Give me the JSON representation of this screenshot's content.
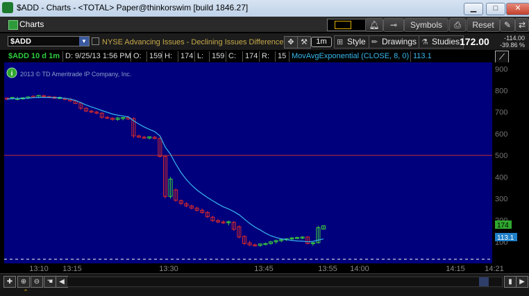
{
  "window": {
    "title": "$ADD - Charts - <TOTAL> Paper@thinkorswim [build 1846.27]",
    "minimize": "▁",
    "maximize": "□",
    "close": "✕"
  },
  "toolbar": {
    "tab_label": "Charts",
    "symbols_label": "Symbols",
    "reset_label": "Reset",
    "alert_icon": "bell-icon",
    "key_icon": "key-icon",
    "print_icon": "printer-icon",
    "pin_icon": "pin-icon"
  },
  "chartbar": {
    "symbol": "$ADD",
    "description": "NYSE Advancing Issues - Declining Issues Difference",
    "aggregation": "1m",
    "style_label": "Style",
    "drawings_label": "Drawings",
    "studies_label": "Studies",
    "last_price": "172.00",
    "net_change": "-114.00",
    "pct_change": "-39.86 %"
  },
  "studybar": {
    "symbol_period": "$ADD 10 d 1m",
    "date": "D: 9/25/13 1:56 PM",
    "o_label": "O:",
    "o_value": "159",
    "h_label": "H:",
    "h_value": "174",
    "l_label": "L:",
    "l_value": "159",
    "c_label": "C:",
    "c_value": "174",
    "r_label": "R:",
    "r_value": "15",
    "study": "MovAvgExponential (CLOSE, 8, 0)",
    "study_value": "113.1"
  },
  "chart": {
    "copyright": "2013 © TD Ameritrade IP Company, Inc.",
    "info_icon": "info-icon",
    "price_label": "174",
    "ema_label": "113.1",
    "colors": {
      "background": "#00007c",
      "up": "#3cd23c",
      "down": "#dd2a2a",
      "ema": "#38b8f0",
      "ref_line": "#c03030",
      "price_tag": "#2fa82f",
      "ema_tag": "#1f7fc8"
    }
  },
  "chart_data": {
    "type": "candlestick",
    "yticks": [
      900,
      800,
      700,
      600,
      500,
      400,
      300,
      200,
      100
    ],
    "y_range": [
      0,
      930
    ],
    "xtick_labels": [
      "13:10",
      "13:15",
      "13:30",
      "13:45",
      "13:55",
      "14:00",
      "14:15",
      "14:21"
    ],
    "reference_line": 500,
    "candles": [
      {
        "o": 765,
        "h": 768,
        "l": 755,
        "c": 760
      },
      {
        "o": 765,
        "h": 770,
        "l": 758,
        "c": 768
      },
      {
        "o": 762,
        "h": 770,
        "l": 755,
        "c": 763
      },
      {
        "o": 763,
        "h": 769,
        "l": 758,
        "c": 766
      },
      {
        "o": 765,
        "h": 772,
        "l": 760,
        "c": 770
      },
      {
        "o": 773,
        "h": 778,
        "l": 765,
        "c": 768
      },
      {
        "o": 768,
        "h": 780,
        "l": 765,
        "c": 777
      },
      {
        "o": 776,
        "h": 780,
        "l": 768,
        "c": 772
      },
      {
        "o": 772,
        "h": 775,
        "l": 765,
        "c": 768
      },
      {
        "o": 770,
        "h": 772,
        "l": 762,
        "c": 764
      },
      {
        "o": 765,
        "h": 772,
        "l": 760,
        "c": 768
      },
      {
        "o": 763,
        "h": 768,
        "l": 755,
        "c": 760
      },
      {
        "o": 760,
        "h": 765,
        "l": 748,
        "c": 752
      },
      {
        "o": 752,
        "h": 756,
        "l": 738,
        "c": 740
      },
      {
        "o": 742,
        "h": 746,
        "l": 710,
        "c": 718
      },
      {
        "o": 718,
        "h": 722,
        "l": 700,
        "c": 705
      },
      {
        "o": 705,
        "h": 710,
        "l": 695,
        "c": 700
      },
      {
        "o": 700,
        "h": 706,
        "l": 690,
        "c": 695
      },
      {
        "o": 695,
        "h": 700,
        "l": 670,
        "c": 676
      },
      {
        "o": 676,
        "h": 682,
        "l": 668,
        "c": 672
      },
      {
        "o": 672,
        "h": 676,
        "l": 660,
        "c": 666
      },
      {
        "o": 666,
        "h": 678,
        "l": 660,
        "c": 673
      },
      {
        "o": 670,
        "h": 677,
        "l": 662,
        "c": 675
      },
      {
        "o": 675,
        "h": 680,
        "l": 664,
        "c": 668
      },
      {
        "o": 670,
        "h": 676,
        "l": 580,
        "c": 590
      },
      {
        "o": 590,
        "h": 596,
        "l": 580,
        "c": 584
      },
      {
        "o": 584,
        "h": 590,
        "l": 578,
        "c": 582
      },
      {
        "o": 580,
        "h": 588,
        "l": 574,
        "c": 586
      },
      {
        "o": 584,
        "h": 590,
        "l": 574,
        "c": 578
      },
      {
        "o": 578,
        "h": 582,
        "l": 490,
        "c": 495
      },
      {
        "o": 495,
        "h": 500,
        "l": 300,
        "c": 310
      },
      {
        "o": 310,
        "h": 400,
        "l": 300,
        "c": 390
      },
      {
        "o": 340,
        "h": 346,
        "l": 285,
        "c": 292
      },
      {
        "o": 290,
        "h": 296,
        "l": 270,
        "c": 278
      },
      {
        "o": 276,
        "h": 284,
        "l": 260,
        "c": 266
      },
      {
        "o": 266,
        "h": 272,
        "l": 250,
        "c": 256
      },
      {
        "o": 256,
        "h": 262,
        "l": 240,
        "c": 246
      },
      {
        "o": 246,
        "h": 254,
        "l": 230,
        "c": 236
      },
      {
        "o": 236,
        "h": 242,
        "l": 210,
        "c": 216
      },
      {
        "o": 214,
        "h": 220,
        "l": 192,
        "c": 198
      },
      {
        "o": 198,
        "h": 206,
        "l": 186,
        "c": 192
      },
      {
        "o": 192,
        "h": 200,
        "l": 182,
        "c": 188
      },
      {
        "o": 188,
        "h": 198,
        "l": 176,
        "c": 193
      },
      {
        "o": 190,
        "h": 196,
        "l": 150,
        "c": 158
      },
      {
        "o": 170,
        "h": 176,
        "l": 116,
        "c": 122
      },
      {
        "o": 125,
        "h": 130,
        "l": 85,
        "c": 92
      },
      {
        "o": 95,
        "h": 104,
        "l": 80,
        "c": 86
      },
      {
        "o": 86,
        "h": 92,
        "l": 78,
        "c": 82
      },
      {
        "o": 83,
        "h": 92,
        "l": 78,
        "c": 90
      },
      {
        "o": 90,
        "h": 96,
        "l": 84,
        "c": 92
      },
      {
        "o": 92,
        "h": 104,
        "l": 86,
        "c": 100
      },
      {
        "o": 100,
        "h": 110,
        "l": 92,
        "c": 106
      },
      {
        "o": 106,
        "h": 114,
        "l": 98,
        "c": 110
      },
      {
        "o": 110,
        "h": 116,
        "l": 104,
        "c": 114
      },
      {
        "o": 114,
        "h": 122,
        "l": 108,
        "c": 118
      },
      {
        "o": 118,
        "h": 124,
        "l": 112,
        "c": 120
      },
      {
        "o": 120,
        "h": 126,
        "l": 112,
        "c": 122
      },
      {
        "o": 122,
        "h": 126,
        "l": 88,
        "c": 92
      },
      {
        "o": 92,
        "h": 100,
        "l": 82,
        "c": 96
      },
      {
        "o": 96,
        "h": 174,
        "l": 92,
        "c": 165
      },
      {
        "o": 159,
        "h": 174,
        "l": 159,
        "c": 174
      }
    ],
    "ema": [
      760,
      762,
      763,
      764,
      765,
      767,
      768,
      768,
      768,
      767,
      766,
      764,
      760,
      754,
      744,
      733,
      724,
      716,
      707,
      699,
      691,
      686,
      682,
      678,
      660,
      645,
      631,
      620,
      610,
      590,
      538,
      505,
      460,
      420,
      388,
      362,
      340,
      322,
      305,
      290,
      275,
      262,
      252,
      240,
      225,
      205,
      185,
      168,
      155,
      140,
      128,
      120,
      114,
      110,
      106,
      104,
      103,
      100,
      102,
      108,
      113.1
    ]
  },
  "bottom": {
    "plus_icon": "plus-icon",
    "zoom_in_icon": "zoom-in-icon",
    "zoom_out_icon": "zoom-out-icon",
    "pan_icon": "hand-icon",
    "left_icon": "arrow-left-icon",
    "right_icon": "arrow-right-icon",
    "expand_icon": "chevron-up-icon"
  }
}
